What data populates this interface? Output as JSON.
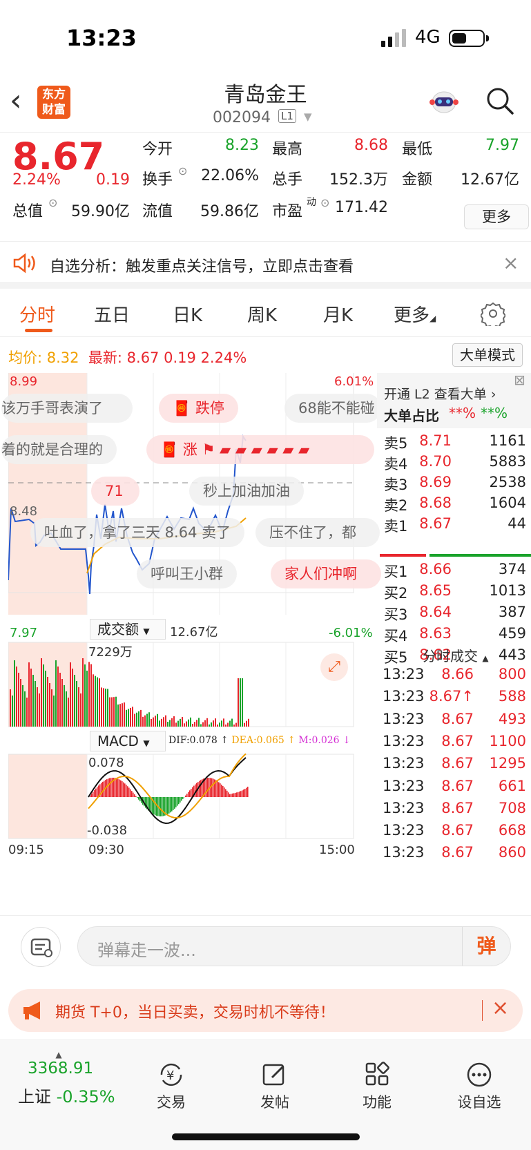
{
  "status_bar": {
    "time": "13:23",
    "network": "4G"
  },
  "header": {
    "logo_line1": "东方",
    "logo_line2": "财富",
    "stock_name": "青岛金王",
    "stock_code": "002094",
    "level": "L1"
  },
  "quote": {
    "price": "8.67",
    "change_pct": "2.24%",
    "change": "0.19",
    "fields": [
      {
        "label": "今开",
        "value": "8.23",
        "color": "#1aa32b"
      },
      {
        "label": "最高",
        "value": "8.68",
        "color": "#e8262d"
      },
      {
        "label": "最低",
        "value": "7.97",
        "color": "#1aa32b"
      },
      {
        "label": "换手",
        "value": "22.06%",
        "color": "#222"
      },
      {
        "label": "总手",
        "value": "152.3万",
        "color": "#222"
      },
      {
        "label": "金额",
        "value": "12.67亿",
        "color": "#222"
      },
      {
        "label": "总值",
        "value": "59.90亿",
        "color": "#222"
      },
      {
        "label": "流值",
        "value": "59.86亿",
        "color": "#222"
      },
      {
        "label": "市盈",
        "value": "171.42",
        "color": "#222"
      }
    ],
    "pe_sup": "动",
    "more_label": "更多"
  },
  "alert": {
    "text": "自选分析：触发重点关注信号，立即点击查看"
  },
  "tabs": [
    "分时",
    "五日",
    "日K",
    "周K",
    "月K",
    "更多"
  ],
  "chart_info": {
    "avg_label": "均价:",
    "avg_value": "8.32",
    "latest_label": "最新:",
    "latest_value": "8.67",
    "change": "0.19",
    "change_pct": "2.24%",
    "big_order_mode": "大单模式"
  },
  "chart_data": {
    "type": "line",
    "price_top": "8.99",
    "price_mid": "8.48",
    "price_bottom": "7.97",
    "pct_top": "6.01%",
    "pct_bottom": "-6.01%",
    "ylim": [
      7.97,
      8.99
    ],
    "volume_selector": "成交额",
    "volume_total": "12.67亿",
    "volume_max": "7229万",
    "macd_selector": "MACD",
    "dif": "DIF:0.078",
    "dea": "DEA:0.065",
    "m": "M:0.026",
    "macd_top": "0.078",
    "macd_bottom": "-0.038",
    "x_ticks": [
      "09:15",
      "09:30",
      "15:00"
    ]
  },
  "danmu": [
    "该万手哥表演了",
    "跌停",
    "68能不能碰",
    "着的就是合理的",
    "71",
    "秒上加油加油",
    "吐血了，拿了三天 8.64 卖了",
    "压不住了，都",
    "呼叫王小群",
    "家人们冲啊"
  ],
  "right_panel": {
    "l2_title": "开通 L2 查看大单",
    "big_ratio_label": "大单占比",
    "big_ratio_red": "**%",
    "big_ratio_green": "**%",
    "asks": [
      {
        "label": "卖5",
        "price": "8.71",
        "vol": "1161"
      },
      {
        "label": "卖4",
        "price": "8.70",
        "vol": "5883"
      },
      {
        "label": "卖3",
        "price": "8.69",
        "vol": "2538"
      },
      {
        "label": "卖2",
        "price": "8.68",
        "vol": "1604"
      },
      {
        "label": "卖1",
        "price": "8.67",
        "vol": "44"
      }
    ],
    "bids": [
      {
        "label": "买1",
        "price": "8.66",
        "vol": "374"
      },
      {
        "label": "买2",
        "price": "8.65",
        "vol": "1013"
      },
      {
        "label": "买3",
        "price": "8.64",
        "vol": "387"
      },
      {
        "label": "买4",
        "price": "8.63",
        "vol": "459"
      },
      {
        "label": "买5",
        "price": "8.62",
        "vol": "443"
      }
    ],
    "trades_title": "分时成交",
    "trades": [
      {
        "time": "13:23",
        "price": "8.66",
        "vol": "800"
      },
      {
        "time": "13:23",
        "price": "8.67↑",
        "vol": "588"
      },
      {
        "time": "13:23",
        "price": "8.67",
        "vol": "493"
      },
      {
        "time": "13:23",
        "price": "8.67",
        "vol": "1100"
      },
      {
        "time": "13:23",
        "price": "8.67",
        "vol": "1295"
      },
      {
        "time": "13:23",
        "price": "8.67",
        "vol": "661"
      },
      {
        "time": "13:23",
        "price": "8.67",
        "vol": "708"
      },
      {
        "time": "13:23",
        "price": "8.67",
        "vol": "668"
      },
      {
        "time": "13:23",
        "price": "8.67",
        "vol": "860"
      }
    ]
  },
  "danmu_bar": {
    "placeholder": "弹幕走一波...",
    "send": "弹"
  },
  "ad": {
    "text": "期货 T+0，当日买卖，交易时机不等待！"
  },
  "bottom_nav": {
    "index_value": "3368.91",
    "index_name": "上证",
    "index_change": "-0.35%",
    "items": [
      "交易",
      "发帖",
      "功能",
      "设自选"
    ]
  }
}
